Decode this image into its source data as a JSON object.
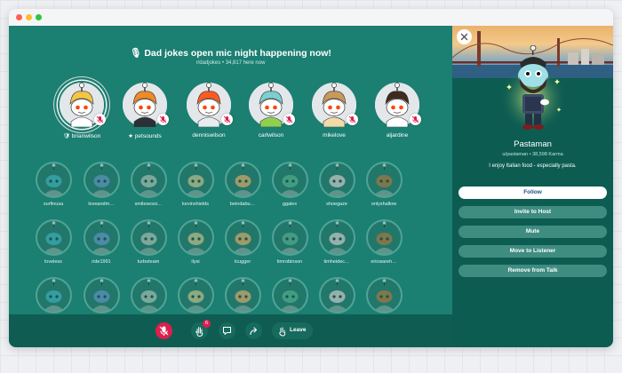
{
  "colors": {
    "stage": "#1b7f72",
    "panel": "#0d5c51",
    "bottombar": "#0f5d52",
    "mic_off": "#e01e4e",
    "notify": "#e01e4e",
    "accent": "#1b4f8a"
  },
  "room": {
    "title": "🎙 Dad jokes open mic night happening now!",
    "subtitle": "r/dadjokes • 34,817 here now"
  },
  "speakers": [
    {
      "name": "brianwilson",
      "prefix": "🛡 ",
      "hair": "#f6c544",
      "shirt": "#ffffff",
      "ring": true
    },
    {
      "name": "petsounds",
      "prefix": "★ ",
      "hair": "#f08a24",
      "shirt": "#2b2f36",
      "ring": false
    },
    {
      "name": "denniswilson",
      "prefix": "",
      "hair": "#ff5a1f",
      "shirt": "#e9ecef",
      "ring": false
    },
    {
      "name": "carlwilson",
      "prefix": "",
      "hair": "#7ccfd0",
      "shirt": "#8fd14f",
      "ring": false
    },
    {
      "name": "mikelove",
      "prefix": "",
      "hair": "#c89a5b",
      "shirt": "#f1dca7",
      "ring": false
    },
    {
      "name": "aljardine",
      "prefix": "",
      "hair": "#3e2a1e",
      "shirt": "#ffffff",
      "ring": false
    }
  ],
  "listeners": [
    "surfinusa",
    "loveandm…",
    "smilesessi…",
    "kevinshields",
    "beindabu…",
    "ggalex",
    "shoegaze",
    "onlyshallow",
    "loveless",
    "ride1991",
    "turboteam",
    "ilysi",
    "tcugger",
    "timrobinson",
    "timheidec…",
    "ericwareh…",
    "",
    "",
    "",
    "",
    "",
    "",
    "",
    ""
  ],
  "controls": {
    "raise_hand_count": "6",
    "leave_label": "Leave"
  },
  "profile": {
    "name": "Pastaman",
    "meta": "u/pastaman • 38,598 Karma",
    "bio": "I enjoy Italian food - especially pasta.",
    "actions": [
      "Follow",
      "Invite to Host",
      "Mute",
      "Move to Listener",
      "Remove from Talk"
    ]
  }
}
